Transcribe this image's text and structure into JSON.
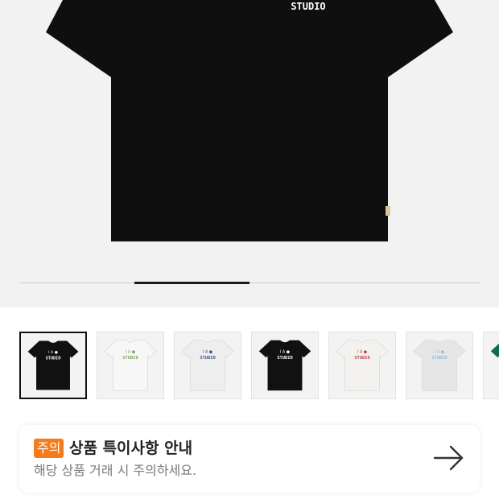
{
  "product_image": {
    "shirt_color": "#0f0f0f",
    "print_text": "STUDIO"
  },
  "gallery_progress": {
    "current_fraction": 0.25
  },
  "thumbnails": [
    {
      "color": "#111111",
      "logo": "#ffffff",
      "selected": true
    },
    {
      "color": "#f7f7f7",
      "logo": "#7fa05a",
      "selected": false
    },
    {
      "color": "#eeeeee",
      "logo": "#3a4f8c",
      "selected": false
    },
    {
      "color": "#111111",
      "logo": "#ffffff",
      "selected": false
    },
    {
      "color": "#f4f2ee",
      "logo": "#b3404a",
      "selected": false
    },
    {
      "color": "#e6e6e6",
      "logo": "#8fbbe0",
      "selected": false
    },
    {
      "color": "#0f6b4f",
      "logo": "#ffffff",
      "selected": false
    }
  ],
  "thumbnail_print": "STUDIO",
  "notice": {
    "badge": "주의",
    "title": "상품 특이사항 안내",
    "subtitle": "해당 상품 거래 시 주의하세요.",
    "arrow_icon": "arrow-right-icon"
  },
  "colors": {
    "badge": "#f77b1a"
  }
}
